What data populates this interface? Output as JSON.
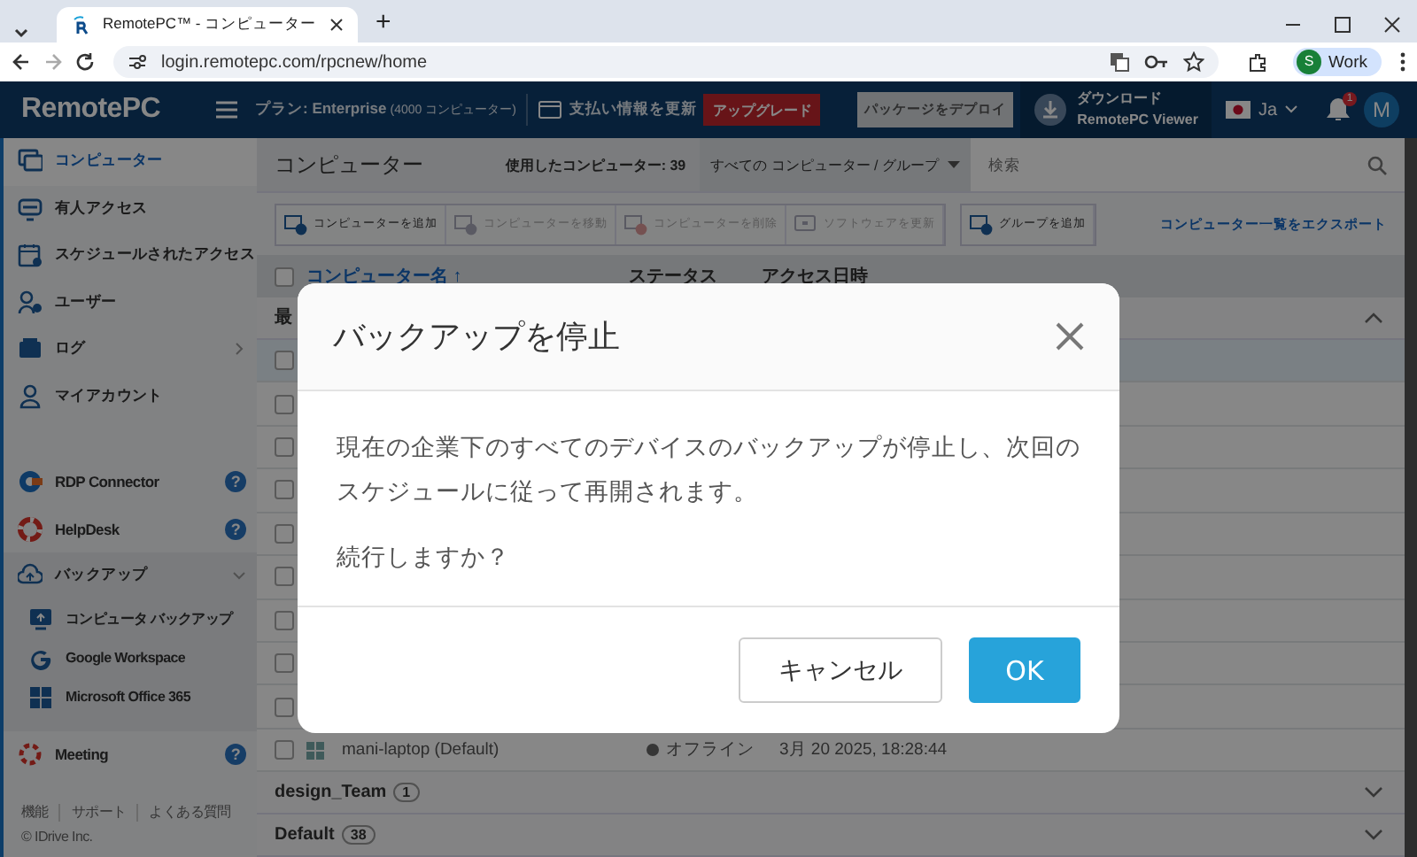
{
  "browser": {
    "tab_title": "RemotePC™ - コンピューター",
    "new_tab": "+",
    "url": "login.remotepc.com/rpcnew/home",
    "profile_initial": "S",
    "profile": "Work"
  },
  "header": {
    "logo": "RemotePC",
    "plan": "プラン: Enterprise",
    "plan_note": "(4000 コンピューター)",
    "billing": "支払い情報を更新",
    "upgrade": "アップグレード",
    "deploy": "パッケージをデプロイ",
    "download_title": "ダウンロード",
    "download_sub": "RemotePC Viewer",
    "language": "Ja",
    "notification_count": "1",
    "avatar": "M"
  },
  "sidebar": {
    "items": [
      {
        "label": "コンピューター",
        "selected": true
      },
      {
        "label": "有人アクセス",
        "selected": false
      },
      {
        "label": "スケジュールされたアクセス",
        "selected": false
      },
      {
        "label": "ユーザー",
        "selected": false
      },
      {
        "label": "ログ",
        "selected": false,
        "expanded": false
      },
      {
        "label": "マイアカウント",
        "selected": false
      }
    ],
    "products": [
      {
        "label": "RDP Connector",
        "help": "?",
        "selected": false
      },
      {
        "label": "HelpDesk",
        "help": "?",
        "selected": false
      },
      {
        "label": "バックアップ",
        "selected": false,
        "expanded": true,
        "children": [
          {
            "label": "コンピュータ バックアップ"
          },
          {
            "label": "Google Workspace"
          },
          {
            "label": "Microsoft Office 365"
          }
        ]
      },
      {
        "label": "Meeting",
        "help": "?",
        "selected": false
      }
    ],
    "footer_links": [
      "機能",
      "サポート",
      "よくある質問"
    ],
    "copyright": "© IDrive Inc."
  },
  "main": {
    "title": "コンピューター",
    "used": "使用したコンピューター: 39",
    "filter": "すべての コンピューター / グループ",
    "search": {
      "placeholder": "検索"
    },
    "toolbar": [
      {
        "label": "コンピューターを追加",
        "disabled": false
      },
      {
        "label": "コンピューターを移動",
        "disabled": true
      },
      {
        "label": "コンピューターを削除",
        "disabled": true
      },
      {
        "label": "ソフトウェアを更新",
        "disabled": true
      },
      {
        "label": "グループを追加",
        "disabled": false
      }
    ],
    "export": "コンピューター一覧をエクスポート",
    "table": {
      "select_all": {
        "checked": false
      },
      "columns": [
        "コンピューター名 ↑",
        "ステータス",
        "アクセス日時"
      ],
      "groups": [
        {
          "name": "最",
          "expanded": true,
          "rows": [
            {
              "checked": false,
              "selected": true
            },
            {
              "checked": false,
              "selected": false
            },
            {
              "checked": false,
              "selected": false
            },
            {
              "checked": false,
              "selected": false
            },
            {
              "checked": false,
              "selected": false
            },
            {
              "checked": false,
              "selected": false
            },
            {
              "checked": false,
              "selected": false
            },
            {
              "checked": false,
              "selected": false
            },
            {
              "checked": false,
              "selected": false
            },
            {
              "checked": false,
              "selected": false,
              "name": "mani-laptop (Default)",
              "status": "オフライン",
              "accessed": "3月 20 2025, 18:28:44"
            }
          ]
        },
        {
          "name": "design_Team",
          "count": "1",
          "expanded": false
        },
        {
          "name": "Default",
          "count": "38",
          "expanded": false
        }
      ]
    }
  },
  "dialog": {
    "title": "バックアップを停止",
    "message": "現在の企業下のすべてのデバイスのバックアップが停止し、次回のスケジュールに従って再開されます。",
    "question": "続行しますか？",
    "buttons": [
      {
        "label": "キャンセル",
        "kind": "secondary"
      },
      {
        "label": "OK",
        "kind": "primary"
      }
    ]
  }
}
